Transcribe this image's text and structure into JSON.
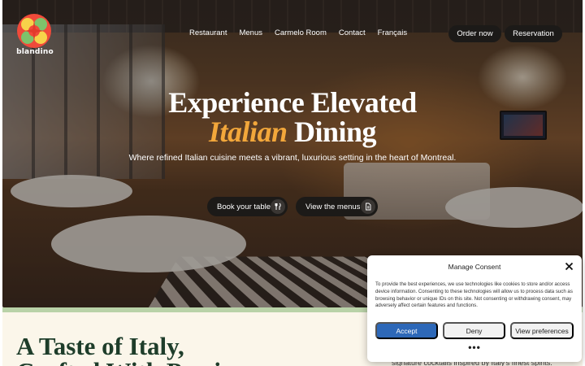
{
  "brand": {
    "name": "blandino"
  },
  "nav": {
    "links": [
      "Restaurant",
      "Menus",
      "Carmelo Room",
      "Contact",
      "Français"
    ],
    "order_label": "Order now",
    "reserve_label": "Reservation"
  },
  "hero": {
    "headline_line1": "Experience Elevated",
    "headline_accent": "Italian",
    "headline_rest": " Dining",
    "subline": "Where refined Italian cuisine meets a vibrant, luxurious setting in the heart of Montreal.",
    "book_label": "Book your table",
    "menus_label": "View the menus"
  },
  "section": {
    "title_line1": "A Taste of Italy,",
    "title_line2": "Crafted With Passion",
    "copy": "signature cocktails inspired by Italy's finest spirits."
  },
  "consent": {
    "title": "Manage Consent",
    "body": "To provide the best experiences, we use technologies like cookies to store and/or access device information. Consenting to these technologies will allow us to process data such as browsing behavior or unique IDs on this site. Not consenting or withdrawing consent, may adversely affect certain features and functions.",
    "accept_label": "Accept",
    "deny_label": "Deny",
    "prefs_label": "View preferences",
    "more_label": "•••"
  },
  "colors": {
    "accent": "#f2a73b",
    "dark_pill": "#1c1a18",
    "consent_accept": "#2d68b8",
    "section_title": "#1e3d2a",
    "section_bg": "#fbf6ea",
    "strip": "#b9d2a8"
  },
  "icons": {
    "logo": "flower-cross-logo",
    "book": "cutlery-icon",
    "menus": "document-icon",
    "close": "close-icon"
  }
}
